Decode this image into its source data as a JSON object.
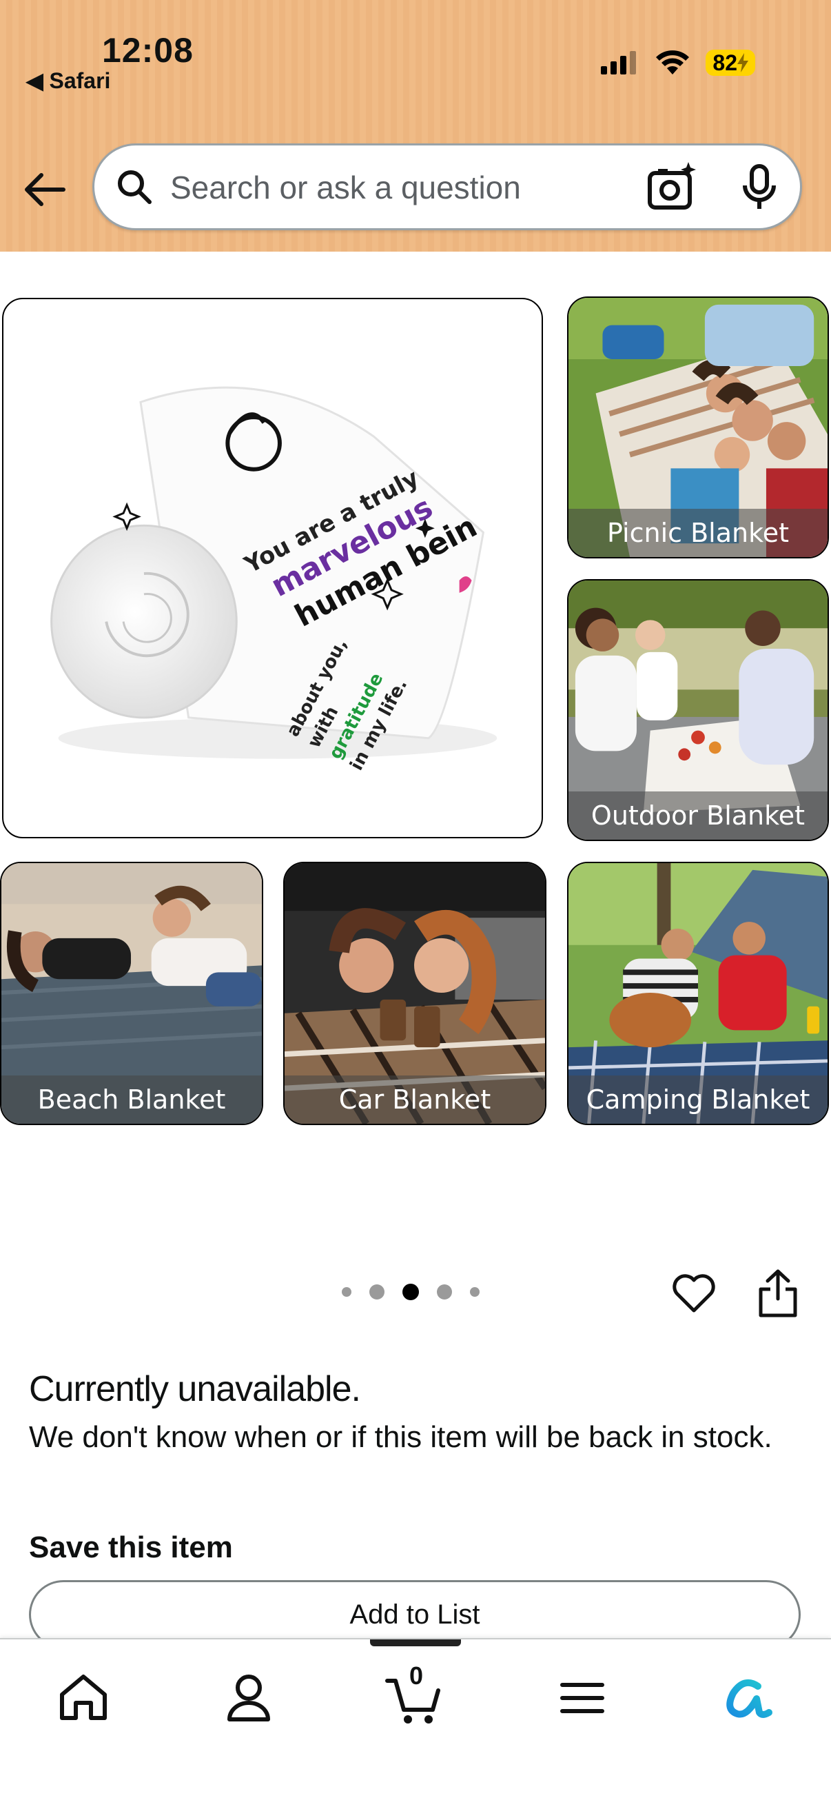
{
  "status_bar": {
    "time": "12:08",
    "back_app": "◀ Safari",
    "battery": "82"
  },
  "search": {
    "placeholder": "Search or ask a question"
  },
  "product_images": {
    "main_alt": "Rolled white blanket printed with 'You are a truly marvelous human being'",
    "main_text_line1": "You are a truly",
    "main_text_line2": "marvelous",
    "main_text_line3": "human bein",
    "tiles": [
      {
        "label": "Picnic Blanket"
      },
      {
        "label": "Outdoor Blanket"
      },
      {
        "label": "Beach Blanket"
      },
      {
        "label": "Car Blanket"
      },
      {
        "label": "Camping Blanket"
      }
    ]
  },
  "carousel": {
    "dot_count": 5,
    "active_index": 2
  },
  "availability": {
    "title": "Currently unavailable.",
    "message": "We don't know when or if this item will be back in stock."
  },
  "save": {
    "heading": "Save this item",
    "add_to_list": "Add to List"
  },
  "bottom_nav": {
    "cart_count": "0",
    "items": [
      "home-icon",
      "account-icon",
      "cart-icon",
      "menu-icon",
      "rufus-icon"
    ]
  },
  "colors": {
    "header_bg": "#f0bb86",
    "battery": "#ffd400",
    "rufus_accent": "#1a8fe0"
  }
}
